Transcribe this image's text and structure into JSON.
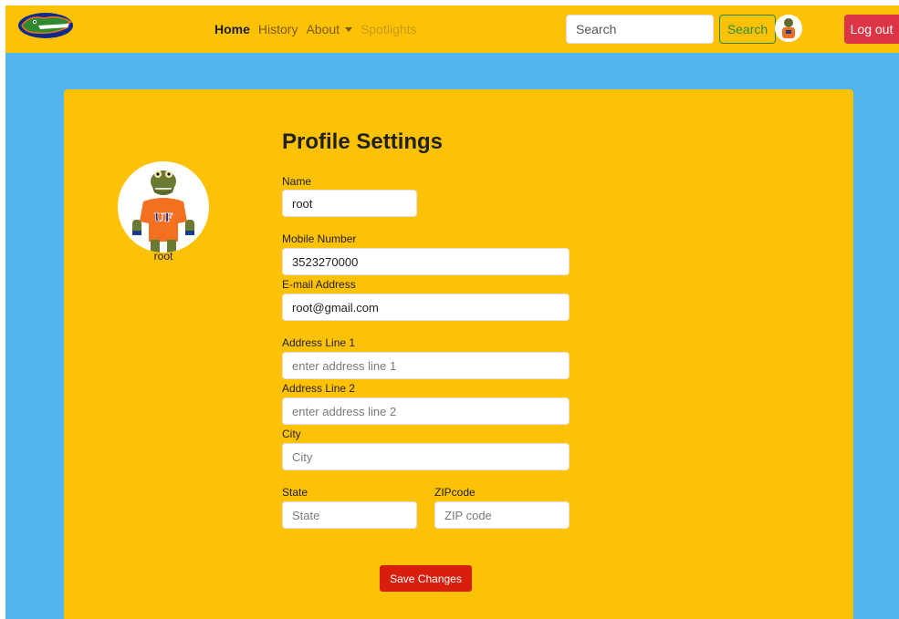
{
  "nav": {
    "links": [
      {
        "label": "Home",
        "state": "active"
      },
      {
        "label": "History",
        "state": "normal"
      },
      {
        "label": "About",
        "state": "dropdown"
      },
      {
        "label": "Spotlights",
        "state": "disabled"
      }
    ],
    "search_placeholder": "Search",
    "search_button": "Search",
    "logout_button": "Log out"
  },
  "profile": {
    "title": "Profile Settings",
    "username": "root",
    "fields": {
      "name": {
        "label": "Name",
        "value": "root",
        "placeholder": ""
      },
      "mobile": {
        "label": "Mobile Number",
        "value": "3523270000",
        "placeholder": ""
      },
      "email": {
        "label": "E-mail Address",
        "value": "root@gmail.com",
        "placeholder": ""
      },
      "address1": {
        "label": "Address Line 1",
        "value": "",
        "placeholder": "enter address line 1"
      },
      "address2": {
        "label": "Address Line 2",
        "value": "",
        "placeholder": "enter address line 2"
      },
      "city": {
        "label": "City",
        "value": "",
        "placeholder": "City"
      },
      "state": {
        "label": "State",
        "value": "",
        "placeholder": "State"
      },
      "zip": {
        "label": "ZIPcode",
        "value": "",
        "placeholder": "ZIP code"
      }
    },
    "save_button": "Save Changes"
  },
  "colors": {
    "navbar": "#fdc206",
    "background": "#52b5f0",
    "danger": "#dc3545",
    "save": "#d81f0d",
    "search_green": "#2e8a3a"
  },
  "icons": {
    "logo": "gator-logo-icon",
    "avatar": "gator-mascot-avatar"
  }
}
